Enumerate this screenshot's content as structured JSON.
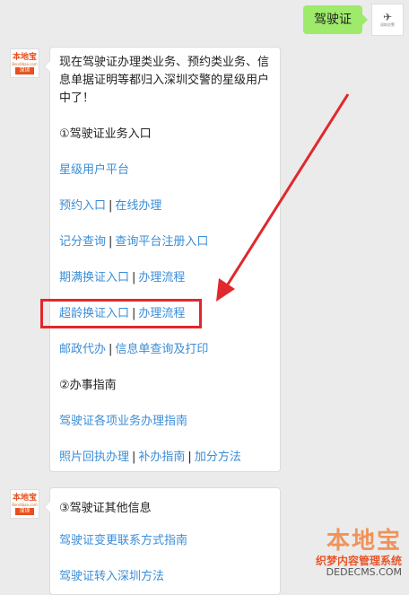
{
  "user_message": {
    "text": "驾驶证",
    "avatar_caption": "深圳交警"
  },
  "bot_avatar": {
    "brand": "本地宝",
    "site": "Bendibao.com",
    "city": "深圳"
  },
  "message1": {
    "intro": "现在驾驶证办理类业务、预约类业务、信息单据证明等都归入深圳交警的星级用户中了！",
    "section1": "①驾驶证业务入口",
    "link_star": "星级用户平台",
    "link_appoint": "预约入口",
    "link_online": "在线办理",
    "link_points": "记分查询",
    "link_register": "查询平台注册入口",
    "link_expire": "期满换证入口",
    "link_expire_flow": "办理流程",
    "link_overage": "超龄换证入口",
    "link_overage_flow": "办理流程",
    "link_post": "邮政代办",
    "link_print": "信息单查询及打印",
    "section2": "②办事指南",
    "link_guide": "驾驶证各项业务办理指南",
    "link_photo": "照片回执办理",
    "link_reissue": "补办指南",
    "link_points_method": "加分方法",
    "separator": "|"
  },
  "message2": {
    "section3": "③驾驶证其他信息",
    "link_contact": "驾驶证变更联系方式指南",
    "link_transfer": "驾驶证转入深圳方法"
  },
  "watermark": {
    "brand": "本地宝",
    "text": "织梦内容管理系统",
    "url": "DEDECMS.COM"
  },
  "colors": {
    "link": "#3b8dd6",
    "highlight": "#e0282d",
    "user_bubble": "#9eea6a"
  }
}
